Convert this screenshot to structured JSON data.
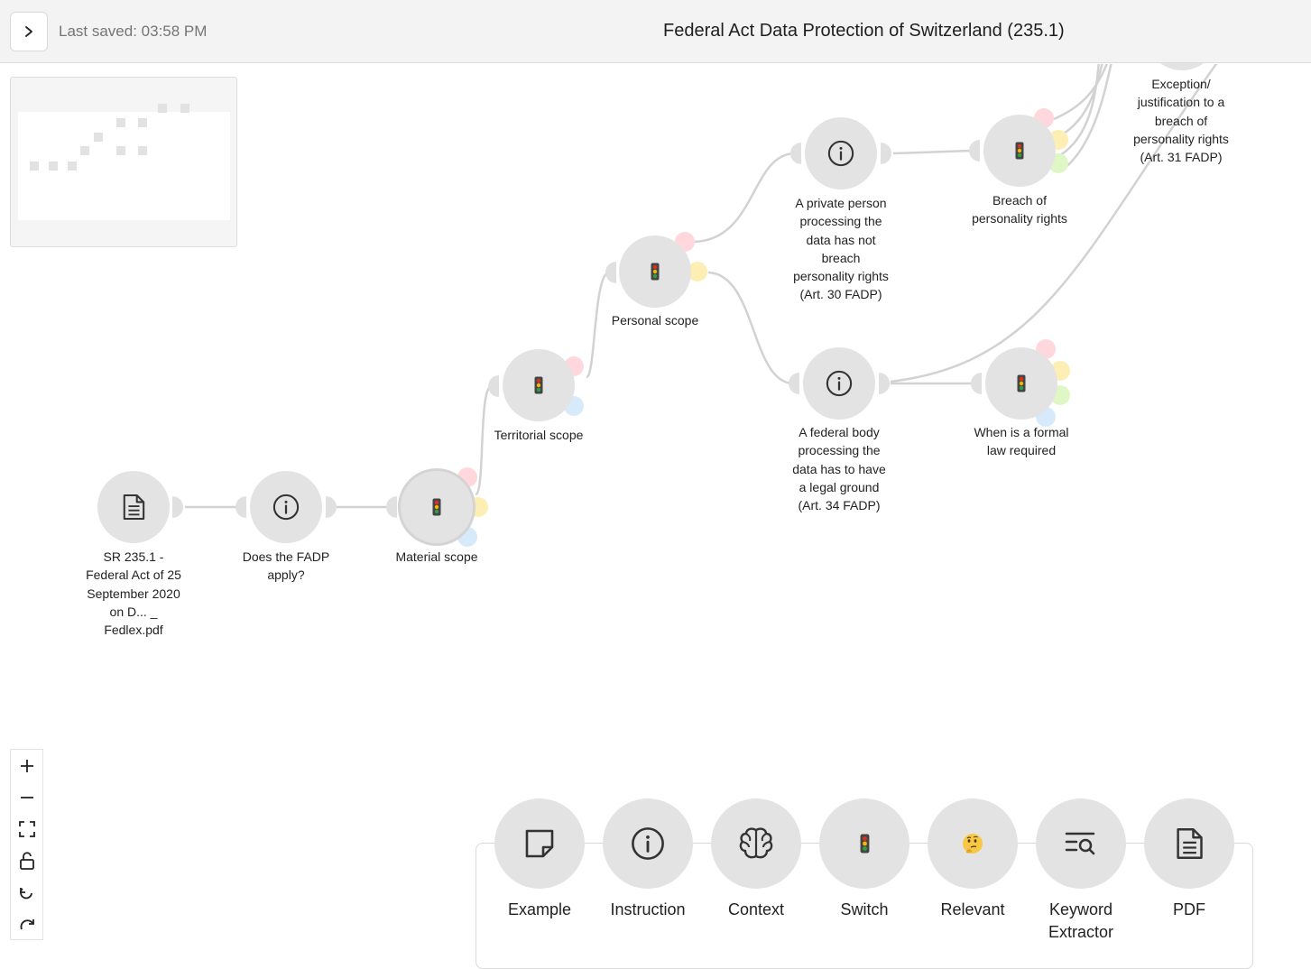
{
  "header": {
    "last_saved": "Last saved: 03:58 PM",
    "title": "Federal Act Data Protection of Switzerland (235.1)"
  },
  "nodes": [
    {
      "id": "pdf",
      "icon": "document-icon",
      "label": "SR 235.1 - Federal Act of 25 September 2020 on D... _ Fedlex.pdf"
    },
    {
      "id": "fadp",
      "icon": "info-icon",
      "label": "Does the FADP apply?"
    },
    {
      "id": "material",
      "icon": "traffic-light-icon",
      "label": "Material scope"
    },
    {
      "id": "territorial",
      "icon": "traffic-light-icon",
      "label": "Territorial scope"
    },
    {
      "id": "personal",
      "icon": "traffic-light-icon",
      "label": "Personal scope"
    },
    {
      "id": "private",
      "icon": "info-icon",
      "label": "A private person processing the data has not breach personality rights (Art. 30 FADP)"
    },
    {
      "id": "federal",
      "icon": "info-icon",
      "label": "A federal body processing the data has to have a legal ground (Art. 34 FADP)"
    },
    {
      "id": "breach",
      "icon": "traffic-light-icon",
      "label": "Breach of personality rights"
    },
    {
      "id": "formal",
      "icon": "traffic-light-icon",
      "label": "When is a formal law required"
    },
    {
      "id": "exception",
      "icon": "",
      "label": "Exception/ justification to a breach of personality rights (Art. 31 FADP)"
    }
  ],
  "palette": [
    {
      "icon": "example-icon",
      "label": "Example"
    },
    {
      "icon": "info-icon",
      "label": "Instruction"
    },
    {
      "icon": "brain-icon",
      "label": "Context"
    },
    {
      "icon": "traffic-light-icon",
      "label": "Switch"
    },
    {
      "icon": "thinking-face-icon",
      "label": "Relevant"
    },
    {
      "icon": "keyword-search-icon",
      "label": "Keyword Extractor"
    },
    {
      "icon": "document-icon",
      "label": "PDF"
    }
  ],
  "controls": [
    "zoom-in-icon",
    "zoom-out-icon",
    "fit-view-icon",
    "unlock-icon",
    "undo-icon",
    "redo-icon"
  ],
  "colors": {
    "node": "#e3e3e3",
    "edge": "#d2d2d2",
    "petal_red": "#ffd7dc",
    "petal_yellow": "#fdeeb3",
    "petal_green": "#def7c5",
    "petal_blue": "#d6eafb",
    "traffic_red": "#d93025",
    "traffic_yellow": "#f4b400",
    "traffic_green": "#2e9e44"
  }
}
